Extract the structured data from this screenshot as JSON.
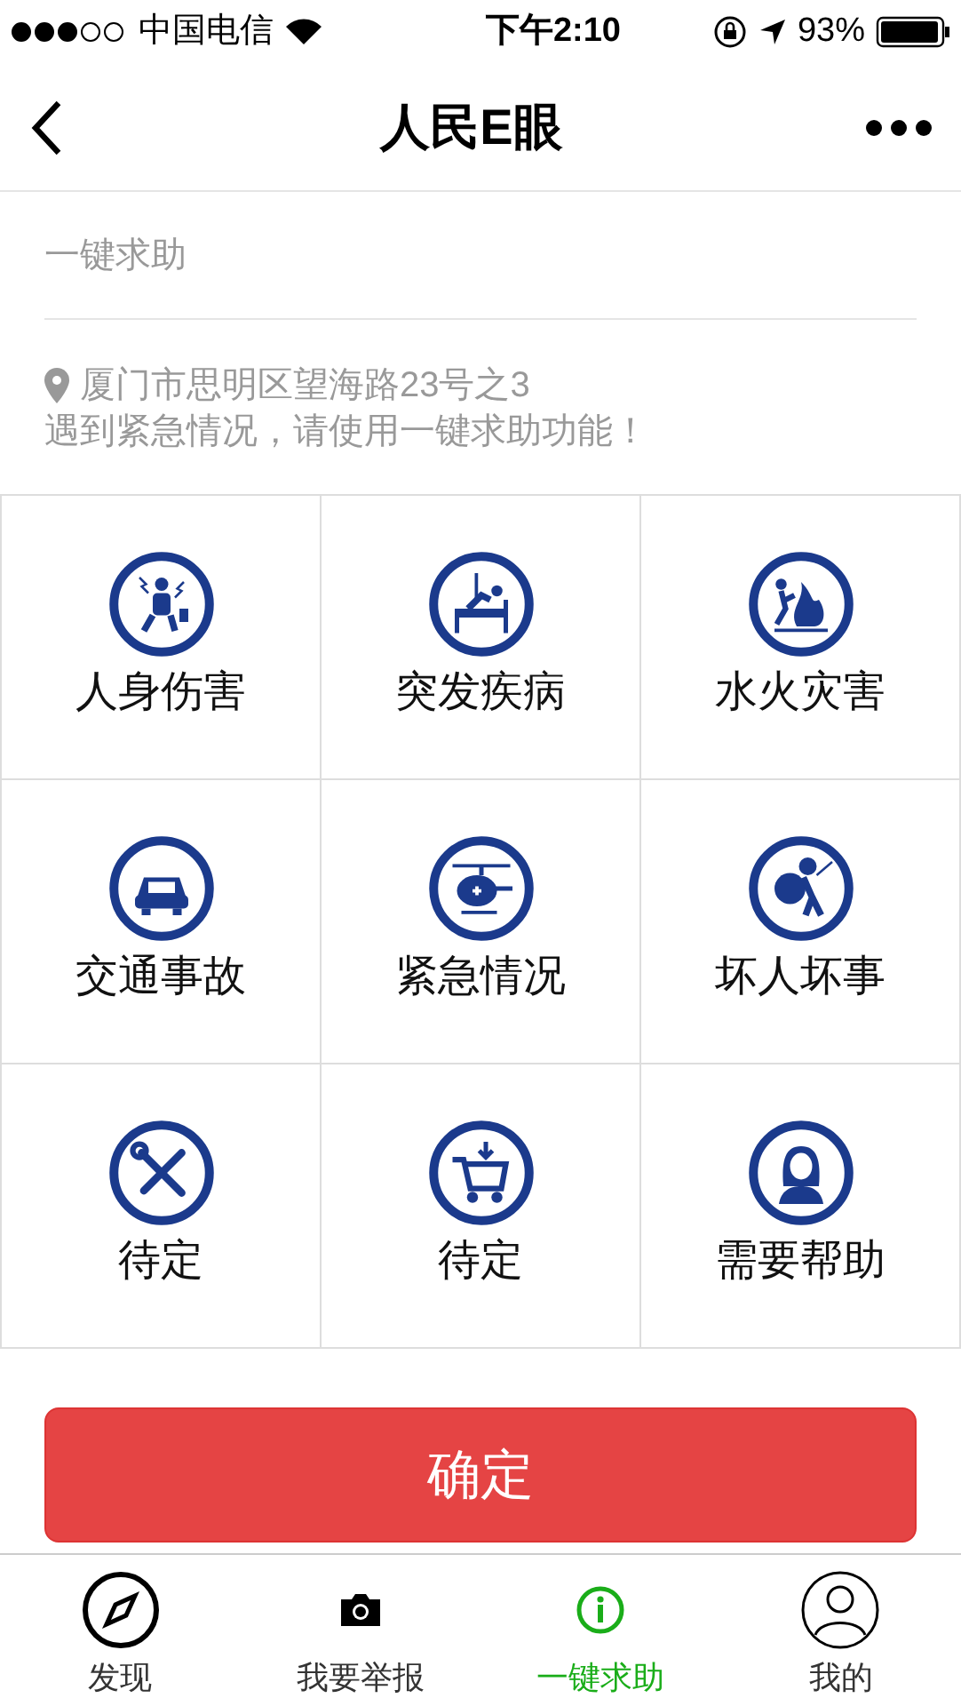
{
  "status_bar": {
    "carrier": "中国电信",
    "time": "下午2:10",
    "battery": "93%"
  },
  "nav": {
    "title": "人民E眼"
  },
  "section": {
    "title": "一键求助"
  },
  "location": {
    "address": "厦门市思明区望海路23号之3",
    "hint": "遇到紧急情况，请使用一键求助功能！"
  },
  "categories": [
    {
      "label": "人身伤害"
    },
    {
      "label": "突发疾病"
    },
    {
      "label": "水火灾害"
    },
    {
      "label": "交通事故"
    },
    {
      "label": "紧急情况"
    },
    {
      "label": "坏人坏事"
    },
    {
      "label": "待定"
    },
    {
      "label": "待定"
    },
    {
      "label": "需要帮助"
    }
  ],
  "confirm_button": "确定",
  "tab_bar": [
    {
      "label": "发现",
      "selected": false
    },
    {
      "label": "我要举报",
      "selected": false
    },
    {
      "label": "一键求助",
      "selected": true
    },
    {
      "label": "我的",
      "selected": false
    }
  ]
}
